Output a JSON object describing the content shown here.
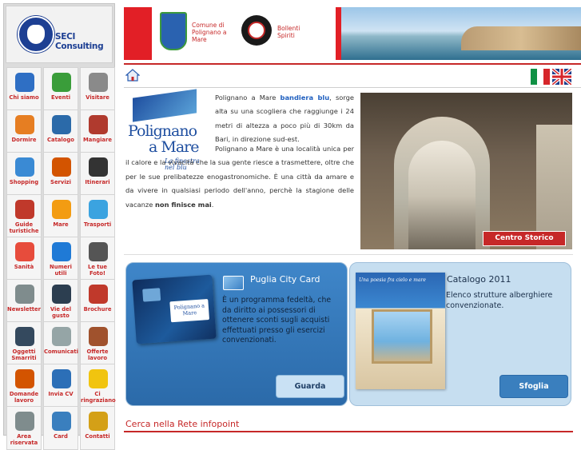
{
  "sidebar": {
    "logo_text": "SECI Consulting",
    "items": [
      {
        "label": "Chi siamo",
        "icon": "person-icon",
        "color": "#2f6fc4"
      },
      {
        "label": "Eventi",
        "icon": "checkmark-icon",
        "color": "#3a9d3a"
      },
      {
        "label": "Visitare",
        "icon": "mountain-icon",
        "color": "#8a8a8a"
      },
      {
        "label": "Dormire",
        "icon": "bed-icon",
        "color": "#e67e22"
      },
      {
        "label": "Catalogo",
        "icon": "catalog-icon",
        "color": "#2b6aa9"
      },
      {
        "label": "Mangiare",
        "icon": "wine-icon",
        "color": "#b03a2e"
      },
      {
        "label": "Shopping",
        "icon": "shopping-bag-icon",
        "color": "#3a8ad4"
      },
      {
        "label": "Servizi",
        "icon": "service-person-icon",
        "color": "#d35400"
      },
      {
        "label": "Itinerari",
        "icon": "signpost-icon",
        "color": "#333333"
      },
      {
        "label": "Guide turistiche",
        "icon": "group-icon",
        "color": "#c0392b"
      },
      {
        "label": "Mare",
        "icon": "beach-icon",
        "color": "#f39c12"
      },
      {
        "label": "Trasporti",
        "icon": "bus-icon",
        "color": "#3ba3e0"
      },
      {
        "label": "Sanità",
        "icon": "medical-icon",
        "color": "#e74c3c"
      },
      {
        "label": "Numeri utili",
        "icon": "phone-icon",
        "color": "#1f7ad6"
      },
      {
        "label": "Le tue Foto!",
        "icon": "camera-icon",
        "color": "#555555"
      },
      {
        "label": "Newsletter",
        "icon": "newsletter-icon",
        "color": "#7f8c8d"
      },
      {
        "label": "Vie del gusto",
        "icon": "bottle-icon",
        "color": "#2c3e50"
      },
      {
        "label": "Brochure",
        "icon": "books-icon",
        "color": "#c0392b"
      },
      {
        "label": "Oggetti Smarriti",
        "icon": "magnifier-icon",
        "color": "#34495e"
      },
      {
        "label": "Comunicati",
        "icon": "megaphone-icon",
        "color": "#95a5a6"
      },
      {
        "label": "Offerte lavoro",
        "icon": "briefcase-icon",
        "color": "#a0522d"
      },
      {
        "label": "Domande lavoro",
        "icon": "handshake-icon",
        "color": "#d35400"
      },
      {
        "label": "Invia CV",
        "icon": "document-icon",
        "color": "#2c6fb7"
      },
      {
        "label": "Ci ringraziano",
        "icon": "sticky-note-icon",
        "color": "#f1c40f"
      },
      {
        "label": "Area riservata",
        "icon": "lock-icon",
        "color": "#7f8c8d"
      },
      {
        "label": "Card",
        "icon": "card-icon",
        "color": "#3a7fbe"
      },
      {
        "label": "Contatti",
        "icon": "at-sign-icon",
        "color": "#d4a017"
      }
    ]
  },
  "header": {
    "comune_text": "Comune di Polignano a Mare",
    "bollenti_text": "Bollenti Spiriti",
    "accent_color": "#e21f26"
  },
  "toolbar": {
    "home_icon": "home-icon",
    "flag_it_icon": "italian-flag-icon",
    "flag_uk_icon": "uk-flag-icon"
  },
  "intro": {
    "logo_line1": "Polignano",
    "logo_line2": "a Mare",
    "logo_tagline": "La finestra nel blu",
    "p1_lead": "Polignano a Mare ",
    "p1_highlight": "bandiera blu",
    "p1_rest": ", sorge alta su una scogliera che raggiunge i 24 metri di altezza a poco più di 30km da Bari, in direzione sud-est.",
    "p2_start": "Polignano a Mare è una località unica per il calore e la vivacità che la sua gente riesce a trasmettere, oltre che per le sue prelibatezze enogastronomiche. È una città da amare e da vivere in qualsiasi periodo dell'anno, perchè la stagione delle vacanze ",
    "p2_bold": "non finisce mai",
    "p2_end": "."
  },
  "photo": {
    "button_label": "Centro Storico"
  },
  "panel_card": {
    "title": "Puglia City Card",
    "description": "È un programma fedeltà, che da diritto ai possessori di ottenere sconti sugli acquisti effettuati presso gli esercizi convenzionati.",
    "button_label": "Guarda",
    "card_caption": "Polignano a Mare"
  },
  "panel_catalog": {
    "title": "Catalogo 2011",
    "description": "Elenco strutture alberghiere convenzionate.",
    "button_label": "Sfoglia",
    "cover_caption": "Una poesia fra cielo e mare"
  },
  "search": {
    "title": "Cerca nella Rete infopoint"
  }
}
